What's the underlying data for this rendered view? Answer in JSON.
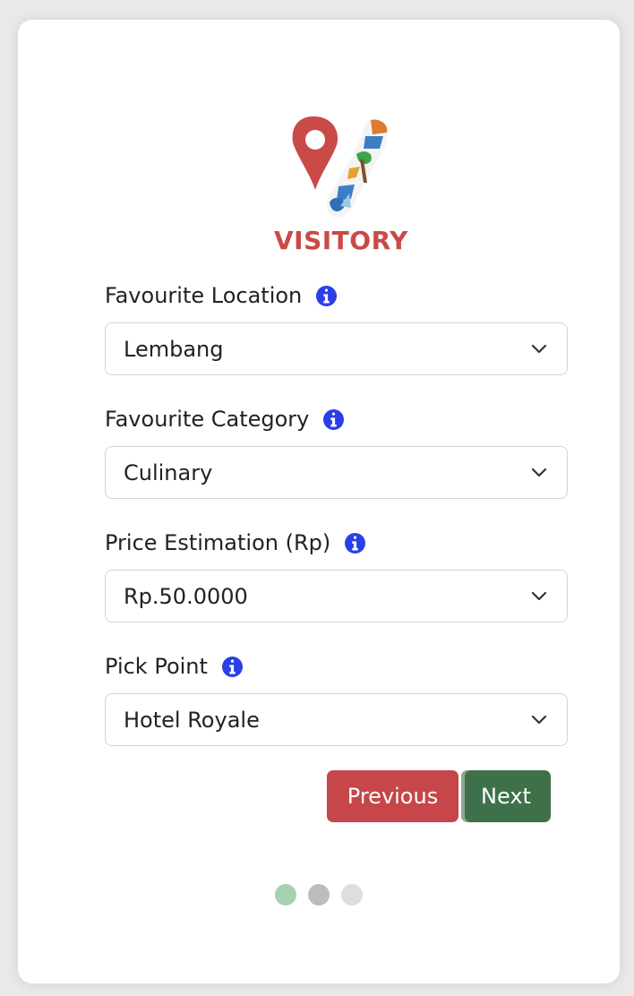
{
  "brand": {
    "name": "VISITORY"
  },
  "form": {
    "fields": [
      {
        "label": "Favourite Location",
        "value": "Lembang"
      },
      {
        "label": "Favourite Category",
        "value": "Culinary"
      },
      {
        "label": "Price Estimation (Rp)",
        "value": "Rp.50.0000"
      },
      {
        "label": "Pick Point",
        "value": "Hotel Royale"
      }
    ]
  },
  "buttons": {
    "previous_label": "Previous",
    "next_label": "Next"
  },
  "pagination": {
    "step_count": 3,
    "current_step": 1
  },
  "colors": {
    "brand_red": "#c94a47",
    "info_blue": "#2a3fe8",
    "previous_button": "#c6464a",
    "next_button": "#3e714a",
    "dot_active": "#a8d0b3",
    "dot_mid": "#bdbdbd",
    "dot_light": "#dedede"
  }
}
